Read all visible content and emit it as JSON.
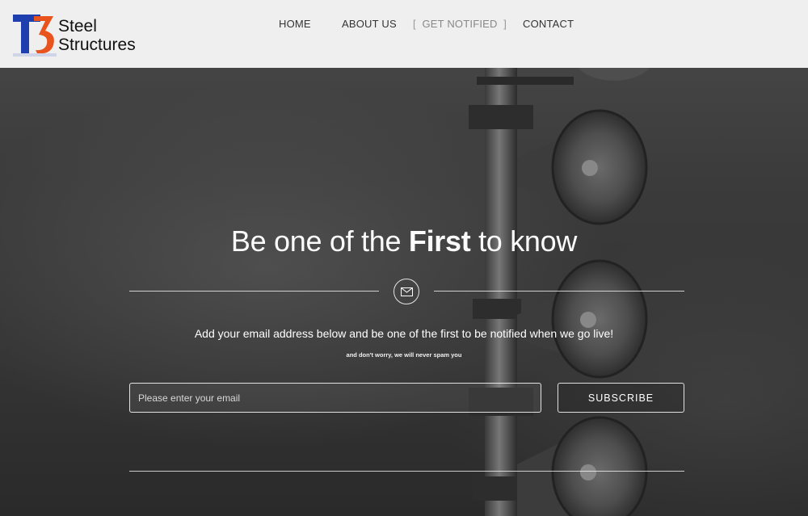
{
  "brand": {
    "name_line1": "Steel",
    "name_line2": "Structures",
    "colors": {
      "blue": "#1f3fae",
      "orange": "#e8531e"
    }
  },
  "nav": {
    "items": [
      {
        "label": "HOME"
      },
      {
        "label": "ABOUT US"
      },
      {
        "label": "GET NOTIFIED",
        "bracket_open": "[",
        "bracket_close": "]"
      },
      {
        "label": "CONTACT"
      }
    ]
  },
  "hero": {
    "headline_pre": "Be one of the ",
    "headline_bold": "First",
    "headline_post": " to know",
    "lead": "Add your email address below and be one of the first to be notified when we go live!",
    "fineprint": "and don't worry, we will never spam you",
    "icon": "envelope-icon"
  },
  "form": {
    "email_placeholder": "Please enter your email",
    "email_value": "",
    "subscribe_label": "SUBSCRIBE"
  }
}
